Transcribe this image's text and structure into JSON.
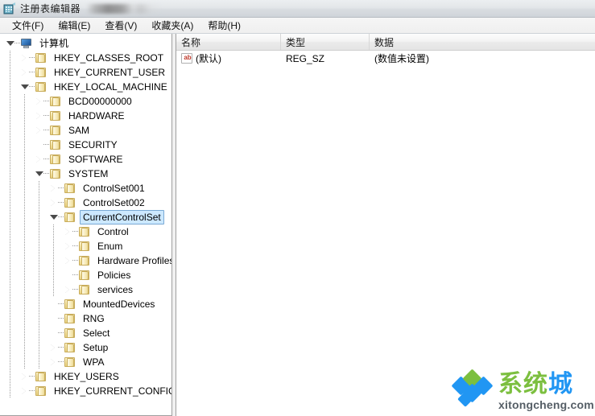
{
  "window": {
    "title": "注册表编辑器",
    "icon": "registry-editor-icon",
    "redacted_suffix": ""
  },
  "menubar": {
    "items": [
      {
        "label": "文件(F)",
        "name": "menu-file"
      },
      {
        "label": "编辑(E)",
        "name": "menu-edit"
      },
      {
        "label": "查看(V)",
        "name": "menu-view"
      },
      {
        "label": "收藏夹(A)",
        "name": "menu-favorites"
      },
      {
        "label": "帮助(H)",
        "name": "menu-help"
      }
    ]
  },
  "tree": {
    "nodes": [
      {
        "label": "计算机",
        "level": 0,
        "state": "expanded",
        "icon": "computer-icon",
        "selected": false
      },
      {
        "label": "HKEY_CLASSES_ROOT",
        "level": 1,
        "state": "collapsed",
        "icon": "folder-icon",
        "selected": false
      },
      {
        "label": "HKEY_CURRENT_USER",
        "level": 1,
        "state": "collapsed",
        "icon": "folder-icon",
        "selected": false
      },
      {
        "label": "HKEY_LOCAL_MACHINE",
        "level": 1,
        "state": "expanded",
        "icon": "folder-icon",
        "selected": false
      },
      {
        "label": "BCD00000000",
        "level": 2,
        "state": "collapsed",
        "icon": "folder-icon",
        "selected": false
      },
      {
        "label": "HARDWARE",
        "level": 2,
        "state": "collapsed",
        "icon": "folder-icon",
        "selected": false
      },
      {
        "label": "SAM",
        "level": 2,
        "state": "collapsed",
        "icon": "folder-icon",
        "selected": false
      },
      {
        "label": "SECURITY",
        "level": 2,
        "state": "leaf",
        "icon": "folder-icon",
        "selected": false
      },
      {
        "label": "SOFTWARE",
        "level": 2,
        "state": "collapsed",
        "icon": "folder-icon",
        "selected": false
      },
      {
        "label": "SYSTEM",
        "level": 2,
        "state": "expanded",
        "icon": "folder-icon",
        "selected": false
      },
      {
        "label": "ControlSet001",
        "level": 3,
        "state": "collapsed",
        "icon": "folder-icon",
        "selected": false
      },
      {
        "label": "ControlSet002",
        "level": 3,
        "state": "collapsed",
        "icon": "folder-icon",
        "selected": false
      },
      {
        "label": "CurrentControlSet",
        "level": 3,
        "state": "expanded",
        "icon": "folder-icon",
        "selected": true
      },
      {
        "label": "Control",
        "level": 4,
        "state": "collapsed",
        "icon": "folder-icon",
        "selected": false
      },
      {
        "label": "Enum",
        "level": 4,
        "state": "collapsed",
        "icon": "folder-icon",
        "selected": false
      },
      {
        "label": "Hardware Profiles",
        "level": 4,
        "state": "collapsed",
        "icon": "folder-icon",
        "selected": false
      },
      {
        "label": "Policies",
        "level": 4,
        "state": "leaf",
        "icon": "folder-icon",
        "selected": false
      },
      {
        "label": "services",
        "level": 4,
        "state": "collapsed",
        "icon": "folder-icon",
        "selected": false
      },
      {
        "label": "MountedDevices",
        "level": 3,
        "state": "leaf",
        "icon": "folder-icon",
        "selected": false
      },
      {
        "label": "RNG",
        "level": 3,
        "state": "leaf",
        "icon": "folder-icon",
        "selected": false
      },
      {
        "label": "Select",
        "level": 3,
        "state": "leaf",
        "icon": "folder-icon",
        "selected": false
      },
      {
        "label": "Setup",
        "level": 3,
        "state": "collapsed",
        "icon": "folder-icon",
        "selected": false
      },
      {
        "label": "WPA",
        "level": 3,
        "state": "collapsed",
        "icon": "folder-icon",
        "selected": false
      },
      {
        "label": "HKEY_USERS",
        "level": 1,
        "state": "collapsed",
        "icon": "folder-icon",
        "selected": false
      },
      {
        "label": "HKEY_CURRENT_CONFIG",
        "level": 1,
        "state": "collapsed",
        "icon": "folder-icon",
        "selected": false
      }
    ]
  },
  "list": {
    "columns": [
      {
        "label": "名称",
        "name": "column-name"
      },
      {
        "label": "类型",
        "name": "column-type"
      },
      {
        "label": "数据",
        "name": "column-data"
      }
    ],
    "rows": [
      {
        "name": "(默认)",
        "type": "REG_SZ",
        "data": "(数值未设置)",
        "icon": "string-value-icon"
      }
    ]
  },
  "watermark": {
    "cn_green": "系统",
    "cn_blue": "城",
    "domain": "xitongcheng.com"
  },
  "colors": {
    "selection_fill": "#cce8ff",
    "selection_border": "#7aa9d4",
    "folder": "#f3e2a0",
    "accent_blue": "#2196f3",
    "accent_green": "#7cbf3f"
  }
}
